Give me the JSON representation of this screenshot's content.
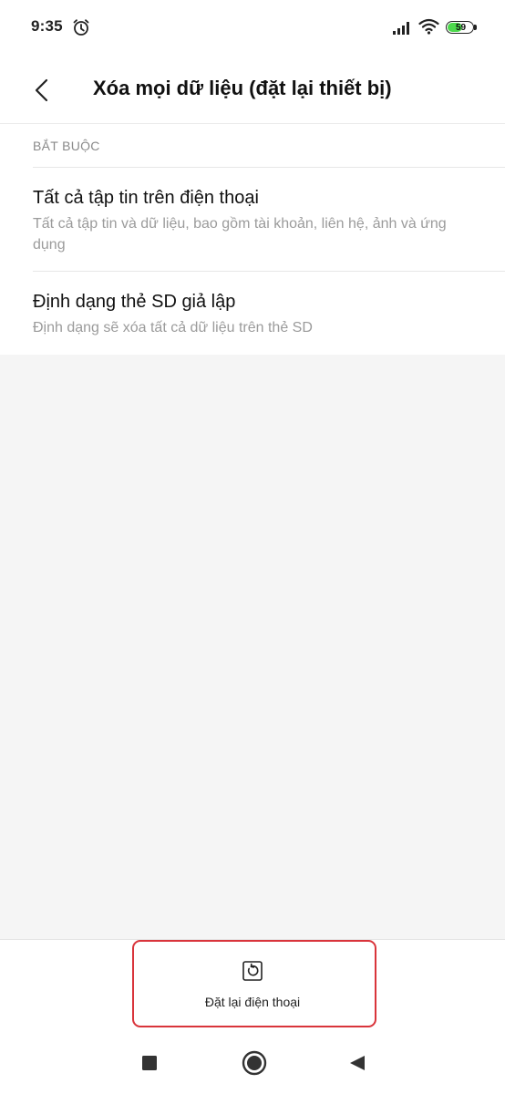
{
  "status_bar": {
    "time": "9:35",
    "battery_level": "59",
    "battery_fraction": 0.59,
    "icons": [
      "alarm-icon",
      "signal-icon",
      "wifi-icon",
      "battery-icon"
    ],
    "battery_color": "#4cd94c"
  },
  "header": {
    "back_icon": "chevron-left-icon",
    "title": "Xóa mọi dữ liệu (đặt lại thiết bị)"
  },
  "section": {
    "label": "BẮT BUỘC"
  },
  "items": [
    {
      "title": "Tất cả tập tin trên điện thoại",
      "description": "Tất cả tập tin và dữ liệu, bao gồm tài khoản, liên hệ, ảnh và ứng dụng"
    },
    {
      "title": "Định dạng thẻ SD giả lập",
      "description": "Định dạng sẽ xóa tất cả dữ liệu trên thẻ SD"
    }
  ],
  "bottom_action": {
    "icon": "reset-icon",
    "label": "Đặt lại điện thoại",
    "highlight_color": "#d9343b"
  },
  "nav_bar": {
    "icons": [
      "recents-square-icon",
      "home-circle-icon",
      "back-triangle-icon"
    ]
  }
}
